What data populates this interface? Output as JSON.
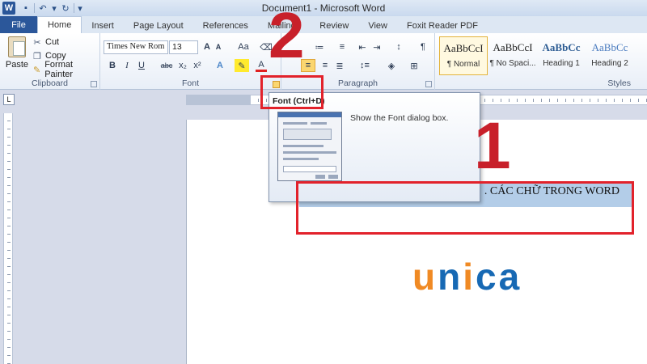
{
  "app": {
    "window_title": "Document1 - Microsoft Word",
    "icon_letter": "W"
  },
  "qat": {
    "save_icon": "save-icon",
    "undo_icon": "undo-icon",
    "redo_icon": "redo-icon"
  },
  "tabs": [
    {
      "label": "File"
    },
    {
      "label": "Home"
    },
    {
      "label": "Insert"
    },
    {
      "label": "Page Layout"
    },
    {
      "label": "References"
    },
    {
      "label": "Mailings"
    },
    {
      "label": "Review"
    },
    {
      "label": "View"
    },
    {
      "label": "Foxit Reader PDF"
    }
  ],
  "clipboard": {
    "paste_label": "Paste",
    "cut_label": "Cut",
    "copy_label": "Copy",
    "format_painter_label": "Format Painter",
    "group_label": "Clipboard"
  },
  "font": {
    "font_name": "Times New Rom",
    "font_size": "13",
    "group_label": "Font",
    "bold": "B",
    "italic": "I",
    "underline": "U",
    "strike": "abc",
    "subscript": "x₂",
    "superscript": "x²",
    "grow": "A",
    "shrink": "A",
    "change_case": "Aa",
    "font_color": "A",
    "text_effects": "A"
  },
  "paragraph": {
    "group_label": "Paragraph",
    "show_marks": "¶"
  },
  "styles": {
    "group_label": "Styles",
    "items": [
      {
        "sample": "AaBbCcI",
        "name": "¶ Normal"
      },
      {
        "sample": "AaBbCcI",
        "name": "¶ No Spaci..."
      },
      {
        "sample": "AaBbCc",
        "name": "Heading 1"
      },
      {
        "sample": "AaBbCc",
        "name": "Heading 2"
      }
    ]
  },
  "ruler_corner": "L",
  "tooltip": {
    "title": "Font (Ctrl+D)",
    "description": "Show the Font dialog box."
  },
  "document": {
    "selected_text": ". CÁC CHỮ TRONG WORD"
  },
  "annotations": {
    "step1": "1",
    "step2": "2"
  },
  "logo": {
    "part1": "u",
    "part2": "n",
    "part3": "i",
    "part4": "c",
    "part5": "a"
  },
  "colors": {
    "file_tab": "#2b579a",
    "annotation_red": "#e2222b",
    "logo_orange": "#f08a24",
    "logo_blue": "#1769b4",
    "selection": "#b3cde8"
  }
}
